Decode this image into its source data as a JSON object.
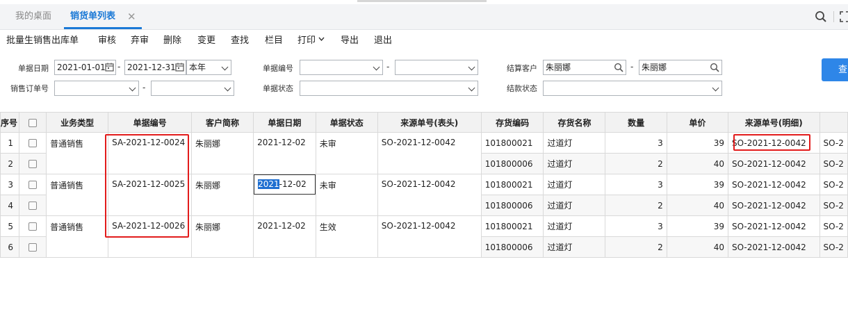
{
  "tabs": {
    "home": "我的桌面",
    "active": "销货单列表",
    "close": "✕"
  },
  "toolbar": {
    "items": [
      "批量生销售出库单",
      "审核",
      "弃审",
      "删除",
      "变更",
      "查找",
      "栏目",
      "打印",
      "导出",
      "退出"
    ]
  },
  "filters": {
    "date_label": "单据日期",
    "date_from": "2021-01-01",
    "date_to": "2021-12-31",
    "period": "本年",
    "docno_label": "单据编号",
    "customer_label": "结算客户",
    "customer_from": "朱丽娜",
    "customer_to": "朱丽娜",
    "order_label": "销售订单号",
    "status_label": "单据状态",
    "settle_label": "结款状态",
    "dash": "-",
    "query_btn": "查"
  },
  "grid": {
    "headers": [
      "序号",
      "",
      "业务类型",
      "单据编号",
      "客户简称",
      "单据日期",
      "单据状态",
      "来源单号(表头)",
      "存货编码",
      "存货名称",
      "数量",
      "单价",
      "来源单号(明细)",
      ""
    ],
    "rows": [
      {
        "idx": "1",
        "type": "普通销售",
        "docno": "SA-2021-12-0024",
        "cust": "朱丽娜",
        "date": "2021-12-02",
        "status": "未审",
        "src": "SO-2021-12-0042",
        "code": "101800021",
        "name": "过道灯",
        "qty": "3",
        "price": "39",
        "srcd": "SO-2021-12-0042",
        "extra": "SO-2"
      },
      {
        "idx": "2",
        "type": "",
        "docno": "",
        "cust": "",
        "date": "",
        "status": "",
        "src": "",
        "code": "101800006",
        "name": "过道灯",
        "qty": "2",
        "price": "40",
        "srcd": "SO-2021-12-0042",
        "extra": "SO-2"
      },
      {
        "idx": "3",
        "type": "普通销售",
        "docno": "SA-2021-12-0025",
        "cust": "朱丽娜",
        "date": "2021-12-02",
        "status": "未审",
        "src": "SO-2021-12-0042",
        "code": "101800021",
        "name": "过道灯",
        "qty": "3",
        "price": "39",
        "srcd": "SO-2021-12-0042",
        "extra": "SO-2"
      },
      {
        "idx": "4",
        "type": "",
        "docno": "",
        "cust": "",
        "date": "",
        "status": "",
        "src": "",
        "code": "101800006",
        "name": "过道灯",
        "qty": "2",
        "price": "40",
        "srcd": "SO-2021-12-0042",
        "extra": "SO-2"
      },
      {
        "idx": "5",
        "type": "普通销售",
        "docno": "SA-2021-12-0026",
        "cust": "朱丽娜",
        "date": "2021-12-02",
        "status": "生效",
        "src": "SO-2021-12-0042",
        "code": "101800021",
        "name": "过道灯",
        "qty": "3",
        "price": "39",
        "srcd": "SO-2021-12-0042",
        "extra": "SO-2"
      },
      {
        "idx": "6",
        "type": "",
        "docno": "",
        "cust": "",
        "date": "",
        "status": "",
        "src": "",
        "code": "101800006",
        "name": "过道灯",
        "qty": "2",
        "price": "40",
        "srcd": "SO-2021-12-0042",
        "extra": "SO-2"
      }
    ],
    "editing_date_selected": "2021",
    "editing_date_rest": "-12-02"
  },
  "colors": {
    "accent": "#1b79d6",
    "highlight_box": "#e21b1b"
  }
}
